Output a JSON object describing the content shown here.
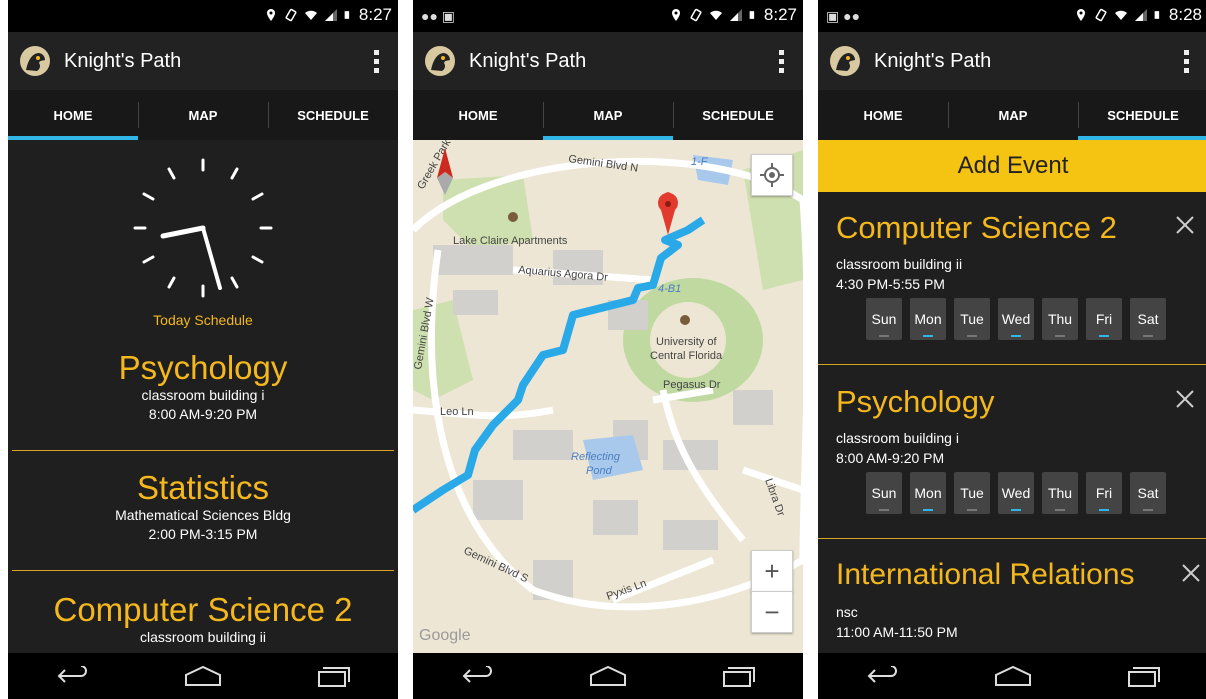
{
  "app": {
    "title": "Knight's Path"
  },
  "tabs": [
    "HOME",
    "MAP",
    "SCHEDULE"
  ],
  "screens": [
    {
      "time": "8:27",
      "active_tab": "HOME"
    },
    {
      "time": "8:27",
      "active_tab": "MAP"
    },
    {
      "time": "8:28",
      "active_tab": "SCHEDULE"
    }
  ],
  "home": {
    "today_label": "Today Schedule",
    "events": [
      {
        "title": "Psychology",
        "location": "classroom building i",
        "time": "8:00 AM-9:20 PM"
      },
      {
        "title": "Statistics",
        "location": "Mathematical Sciences Bldg",
        "time": "2:00 PM-3:15 PM"
      },
      {
        "title": "Computer Science 2",
        "location": "classroom building ii",
        "time": ""
      }
    ]
  },
  "map": {
    "labels": {
      "lake_claire": "Lake Claire Apartments",
      "aquarius": "Aquarius Agora Dr",
      "gemini_n": "Gemini Blvd N",
      "gemini_w": "Gemini Blvd W",
      "gemini_s": "Gemini Blvd S",
      "ucf1": "University of",
      "ucf2": "Central Florida",
      "b41": "4-B1",
      "f1": "1-F",
      "leo": "Leo Ln",
      "pegasus": "Pegasus Dr",
      "reflecting1": "Reflecting",
      "reflecting2": "Pond",
      "libra": "Libra Dr",
      "pyxis": "Pyxis Ln",
      "greek": "Greek Park Dr",
      "google": "Google"
    },
    "zoom_in": "+",
    "zoom_out": "−"
  },
  "schedule": {
    "add_event": "Add Event",
    "day_labels": [
      "Sun",
      "Mon",
      "Tue",
      "Wed",
      "Thu",
      "Fri",
      "Sat"
    ],
    "events": [
      {
        "title": "Computer Science 2",
        "location": "classroom building ii",
        "time": "4:30 PM-5:55 PM",
        "active_days": [
          1,
          3,
          5
        ]
      },
      {
        "title": "Psychology",
        "location": "classroom building i",
        "time": "8:00 AM-9:20 PM",
        "active_days": [
          1,
          3,
          5
        ]
      },
      {
        "title": "International Relations",
        "location": "nsc",
        "time": "11:00 AM-11:50 PM",
        "active_days": []
      }
    ]
  },
  "colors": {
    "accent": "#f5b81c",
    "tab_indicator": "#2fb5e6",
    "route": "#29a9e8"
  }
}
